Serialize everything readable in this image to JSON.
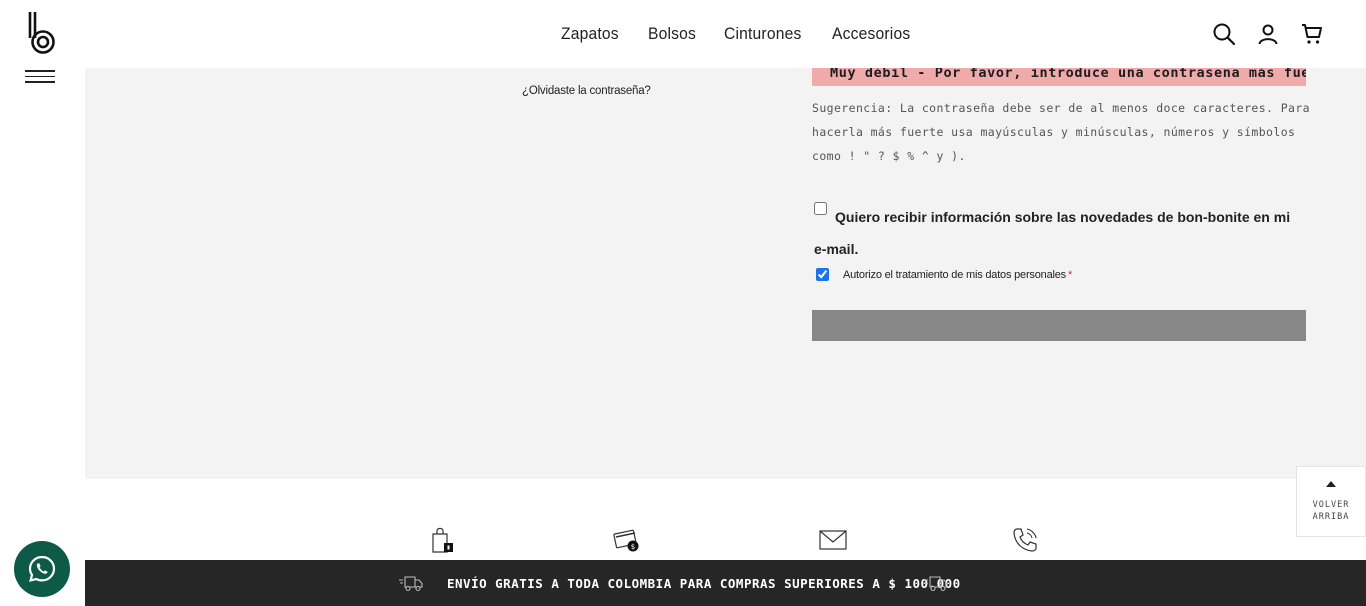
{
  "header": {
    "nav": [
      {
        "label": "Zapatos"
      },
      {
        "label": "Bolsos"
      },
      {
        "label": "Cinturones"
      },
      {
        "label": "Accesorios"
      }
    ],
    "icons": [
      "search-icon",
      "user-icon",
      "cart-icon"
    ]
  },
  "login": {
    "forgot_password": "¿Olvidaste la contraseña?"
  },
  "register": {
    "strength_message": "Muy débil - Por favor, introduce una contraseña más fuerte.",
    "hint": "Sugerencia: La contraseña debe ser de al menos doce caracteres. Para hacerla más fuerte usa mayúsculas y minúsculas, números y símbolos como ! \" ? $ % ^ y ).",
    "newsletter_label": "Quiero recibir información sobre las novedades de bon-bonite en mi e-mail.",
    "newsletter_checked": false,
    "consent_label": "Autorizo el tratamiento de mis datos personales",
    "consent_required_mark": "*",
    "consent_checked": true
  },
  "footer": {
    "features_icons": [
      "secure-bag-icon",
      "card-payment-icon",
      "mail-icon",
      "phone-icon"
    ],
    "shipping_text": "ENVÍO GRATIS A TODA COLOMBIA PARA COMPRAS SUPERIORES A $ 100.000",
    "back_to_top": "VOLVER ARRIBA"
  },
  "colors": {
    "strength_bg": "#f1aaaa",
    "button_bg": "#878787",
    "shipbar_bg": "#262626",
    "whatsapp_bg": "#0d5a48",
    "main_bg": "#f3f3f3"
  }
}
